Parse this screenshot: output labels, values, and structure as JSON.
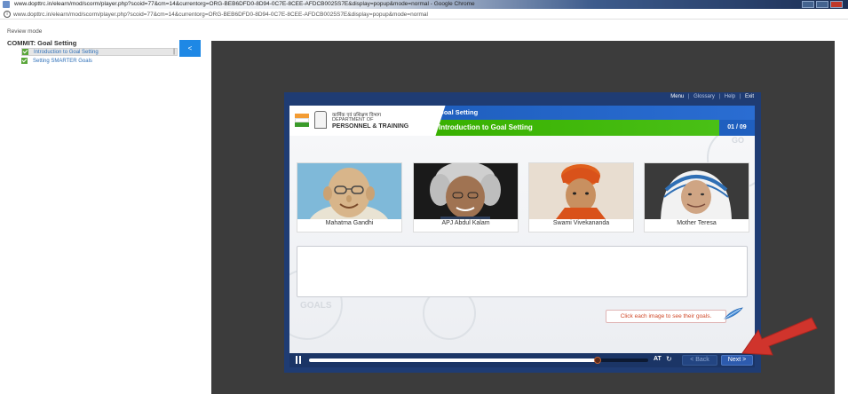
{
  "browser": {
    "title": "www.dopttrc.in/elearn/mod/scorm/player.php?scoid=77&cm=14&currentorg=ORG-BEB6DFD0-8D94-0C7E-8CEE-AFDCB0025S7E&display=popup&mode=normal - Google Chrome",
    "url": "www.dopttrc.in/elearn/mod/scorm/player.php?scoid=77&cm=14&currentorg=ORG-BEB6DFD0-8D94-0C7E-8CEE-AFDCB0025S7E&display=popup&mode=normal"
  },
  "review_mode": "Review mode",
  "toc": {
    "course_title": "COMMIT: Goal Setting",
    "items": [
      {
        "label": "Introduction to Goal Setting",
        "active": true
      },
      {
        "label": "Setting SMARTER Goals"
      }
    ],
    "collapse_label": "<"
  },
  "module": {
    "topnav": {
      "menu": "Menu",
      "glossary": "Glossary",
      "help": "Help",
      "exit": "Exit",
      "sep": "|"
    },
    "logo": {
      "hindi": "कार्मिक एवं प्रशिक्षण विभाग",
      "dept": "DEPARTMENT OF",
      "name": "PERSONNEL & TRAINING"
    },
    "section_title": "Goal Setting",
    "page_title": "Introduction to Goal Setting",
    "page_counter": "01 / 09",
    "people": [
      {
        "name": "Mahatma Gandhi"
      },
      {
        "name": "APJ Abdul Kalam"
      },
      {
        "name": "Swami Vivekananda"
      },
      {
        "name": "Mother Teresa"
      }
    ],
    "watermarks": {
      "go": "GO",
      "goals": "GOALS"
    },
    "hint": "Click each image to see their goals.",
    "controls": {
      "progress": 0.85,
      "at_label": "AT",
      "replay_glyph": "↻",
      "back_label": "< Back",
      "next_label": "Next >"
    }
  },
  "colors": {
    "brand_blue": "#1f5fbf",
    "brand_green": "#38b000",
    "frame": "#1f3c73",
    "annotation_arrow": "#d0342c"
  }
}
